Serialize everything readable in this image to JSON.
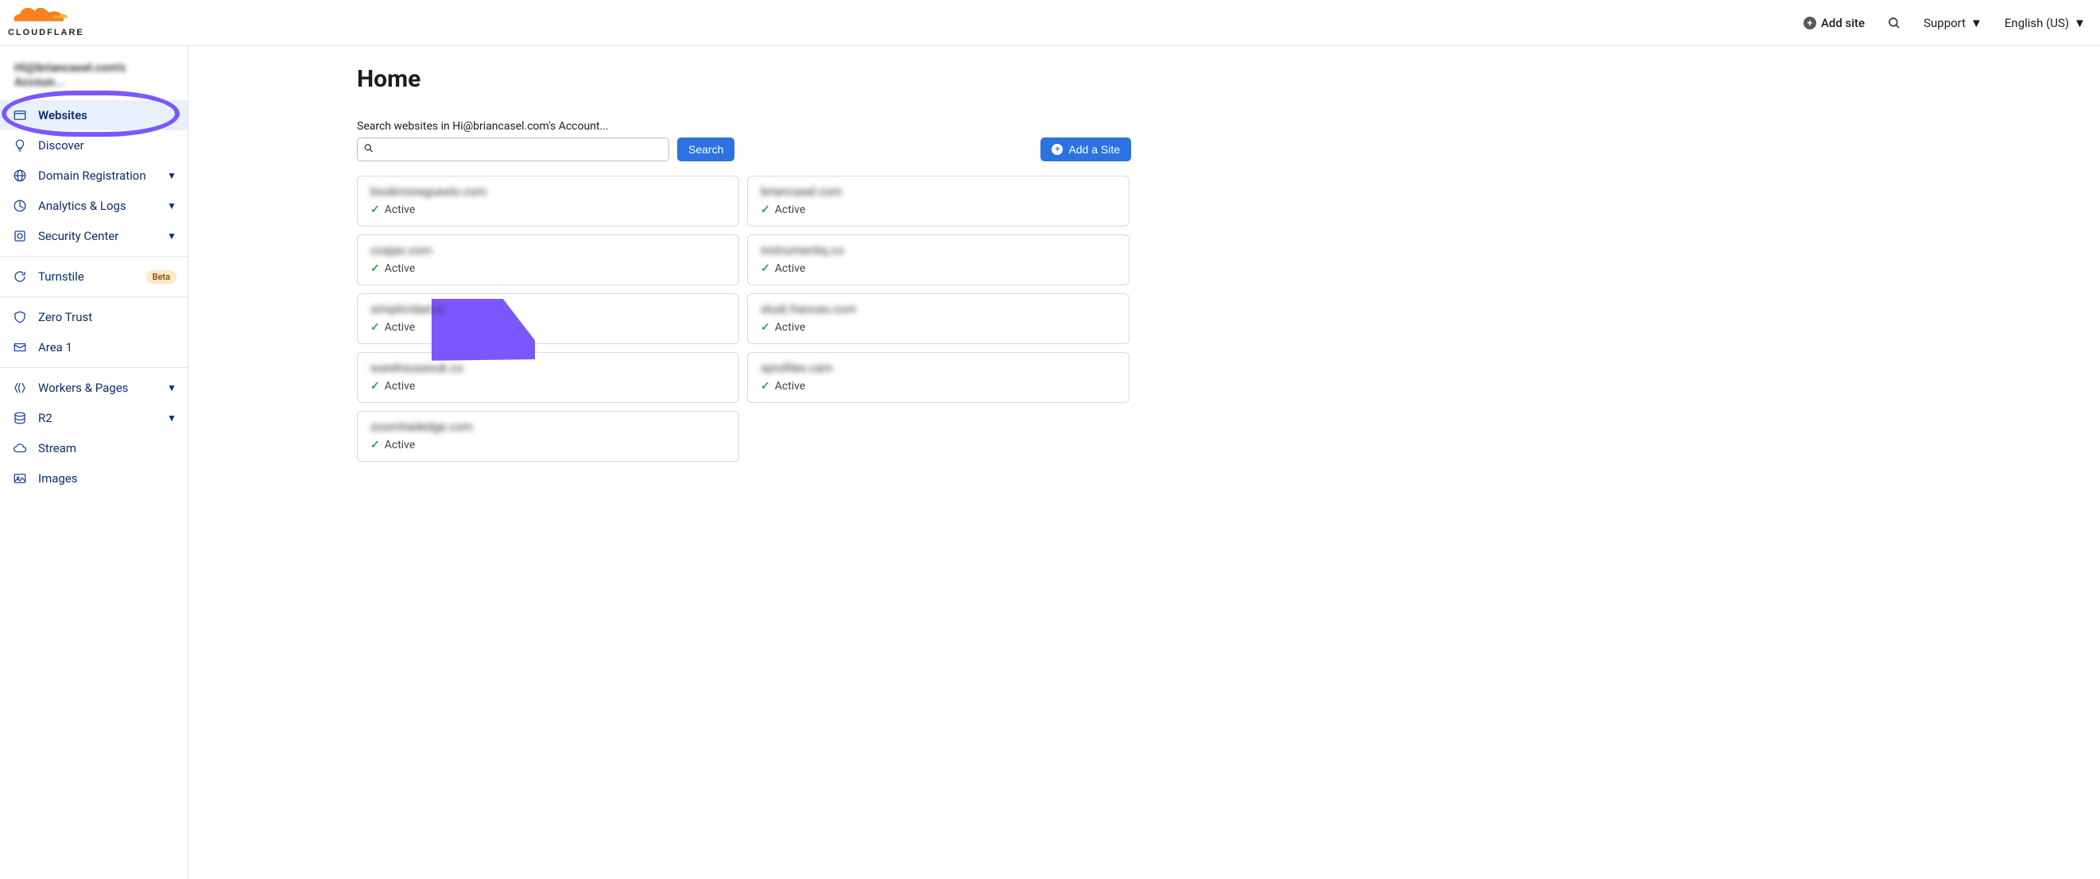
{
  "header": {
    "add_site_label": "Add site",
    "support_label": "Support",
    "language_label": "English (US)"
  },
  "sidebar": {
    "account_name": "Hi@briancasel.com's Accoun...",
    "items": [
      {
        "label": "Websites"
      },
      {
        "label": "Discover"
      },
      {
        "label": "Domain Registration"
      },
      {
        "label": "Analytics & Logs"
      },
      {
        "label": "Security Center"
      },
      {
        "label": "Turnstile",
        "badge": "Beta"
      },
      {
        "label": "Zero Trust"
      },
      {
        "label": "Area 1"
      },
      {
        "label": "Workers & Pages"
      },
      {
        "label": "R2"
      },
      {
        "label": "Stream"
      },
      {
        "label": "Images"
      }
    ]
  },
  "main": {
    "title": "Home",
    "search_label": "Search websites in Hi@briancasel.com's Account...",
    "search_button": "Search",
    "add_site_button": "Add a Site",
    "status_active": "Active",
    "sites": [
      {
        "name": "bookmoreguests.com"
      },
      {
        "name": "briancasel.com"
      },
      {
        "name": "coajax.com"
      },
      {
        "name": "instrumentiq.co"
      },
      {
        "name": "simplicidad.io"
      },
      {
        "name": "studi.frances.com"
      },
      {
        "name": "warehousexuk.co"
      },
      {
        "name": "xprofiles.cam"
      },
      {
        "name": "zoomhadedge.com"
      }
    ]
  }
}
